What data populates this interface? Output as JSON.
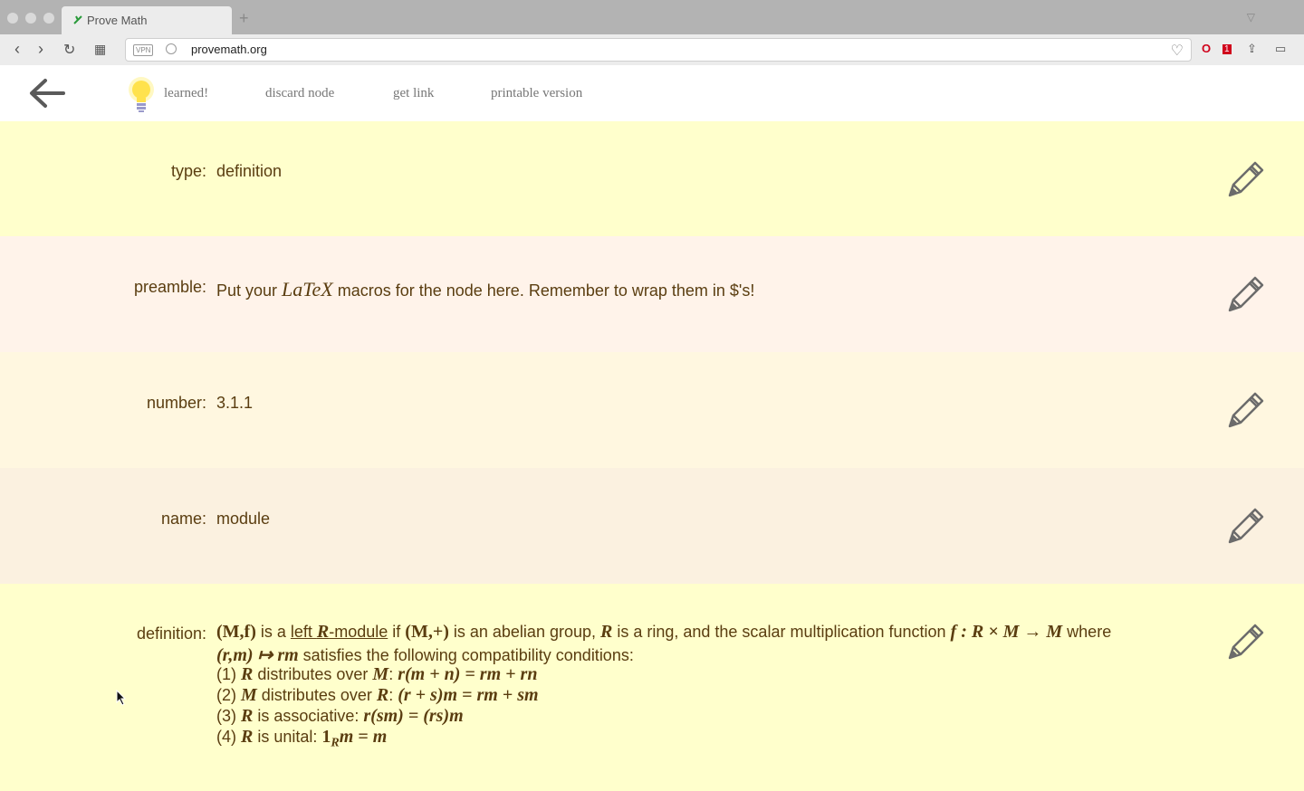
{
  "browser": {
    "tab_title": "Prove Math",
    "new_tab_symbol": "+",
    "url": "provemath.org",
    "vpn_badge": "VPN"
  },
  "topnav": {
    "learned": "learned!",
    "discard": "discard node",
    "get_link": "get link",
    "printable": "printable version"
  },
  "fields": {
    "type": {
      "label": "type:",
      "value": "definition",
      "color": "#ffffcc"
    },
    "preamble": {
      "label": "preamble:",
      "before": "Put your ",
      "latex": "LaTeX",
      "after": " macros for the node here. Remember to wrap them in $'s!",
      "color": "#fff3ea"
    },
    "number": {
      "label": "number:",
      "value": "3.1.1",
      "color": "#fff7e0"
    },
    "name": {
      "label": "name:",
      "value": "module",
      "color": "#fbf1e0"
    },
    "definition": {
      "label": "definition:",
      "color": "#ffffcc",
      "line1": {
        "m1": "(M,f)",
        "t1": " is a ",
        "link": "left ",
        "link_r": "R",
        "link_end": "-module",
        "t2": " if ",
        "m2": "(M,+)",
        "t3": " is an abelian group, ",
        "m3": "R",
        "t4": " is a ring, and the scalar multiplication function ",
        "m4": "f : R × M → M",
        "t5": " where"
      },
      "line2": {
        "m1": "(r,m) ↦ rm",
        "t1": " satisfies the following compatibility conditions:"
      },
      "cond1": {
        "n": "(1) ",
        "m1": "R",
        "t1": " distributes over ",
        "m2": "M",
        "t2": ": ",
        "m3": "r(m + n) = rm + rn"
      },
      "cond2": {
        "n": "(2) ",
        "m1": "M",
        "t1": " distributes over ",
        "m2": "R",
        "t2": ": ",
        "m3": "(r + s)m = rm + sm"
      },
      "cond3": {
        "n": "(3) ",
        "m1": "R",
        "t1": " is associative: ",
        "m3": "r(sm) = (rs)m"
      },
      "cond4": {
        "n": "(4) ",
        "m1": "R",
        "t1": " is unital: ",
        "one": "1",
        "sub": "R",
        "m3": "m = m"
      }
    }
  },
  "colors": {
    "text": "#5a3d10",
    "link": "#777777"
  }
}
